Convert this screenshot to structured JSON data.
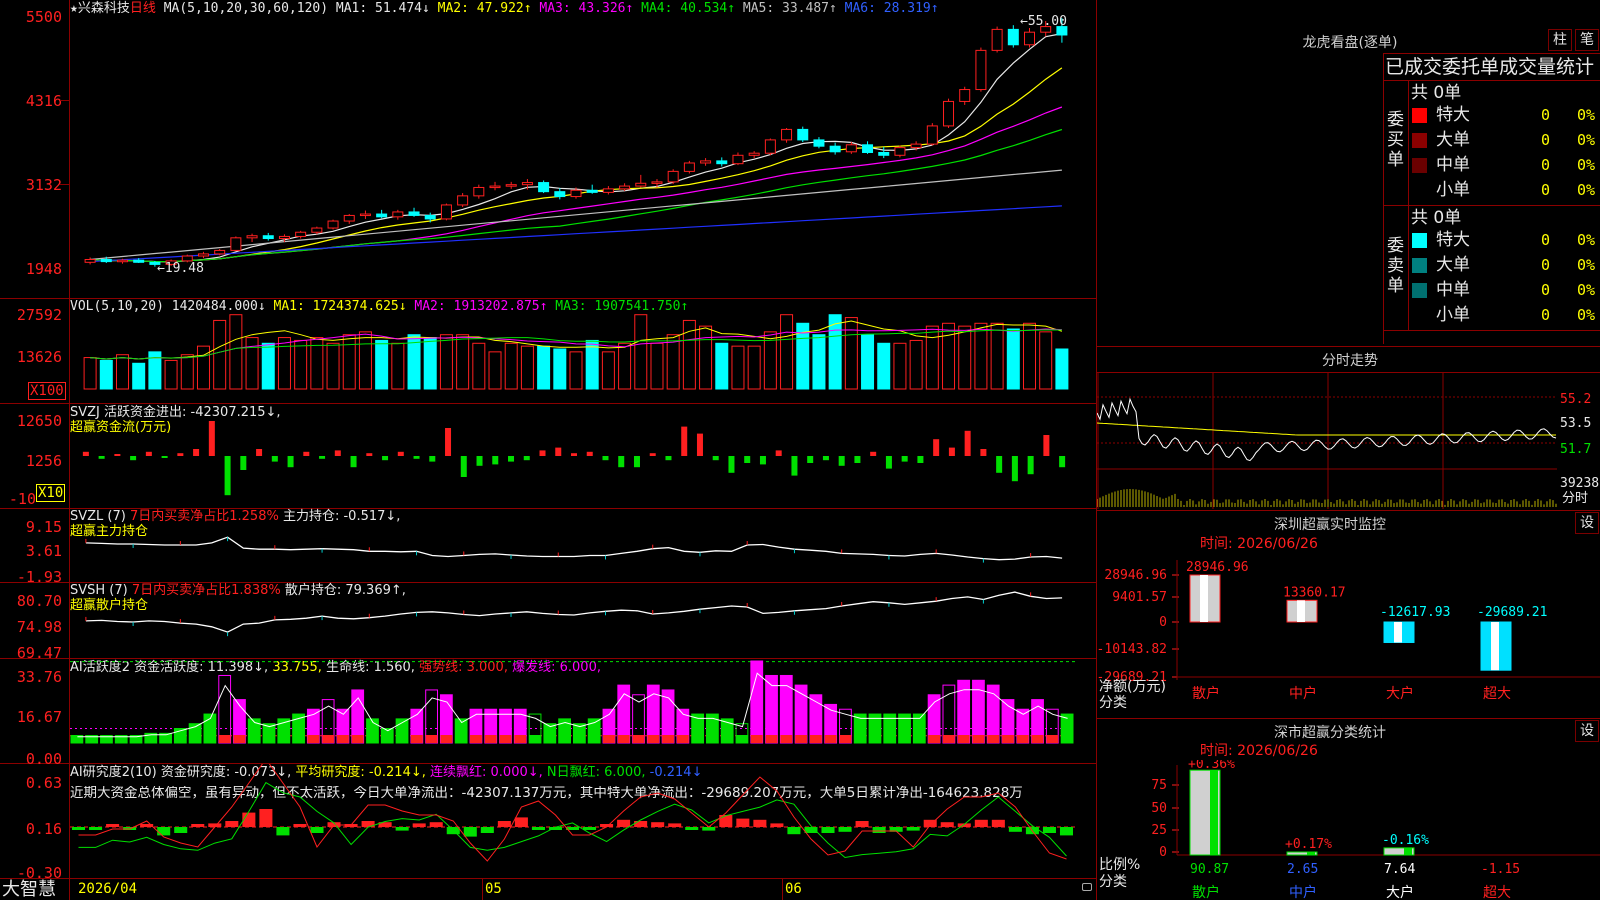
{
  "colors": {
    "up": "#ff2020",
    "down": "#00ffff",
    "grid": "#8b0000",
    "ma1": "#e8e8e8",
    "ma2": "#ffff00",
    "ma3": "#ff00ff",
    "ma4": "#00e000",
    "ma5": "#c0c0c0",
    "ma6": "#2030ff"
  },
  "main": {
    "star": "★",
    "stock": "兴森科技",
    "period": "日线",
    "ma_params": "MA(5,10,20,30,60,120)",
    "ma1": "MA1: 51.474↓",
    "ma2": "MA2: 47.922↑",
    "ma3": "MA3: 43.326↑",
    "ma4": "MA4: 40.534↑",
    "ma5": "MA5: 33.487↑",
    "ma6": "MA6: 28.319↑",
    "high_mark": "55.00",
    "low_mark": "19.48",
    "y_ticks": [
      "5500",
      "4316",
      "3132",
      "1948"
    ]
  },
  "vol": {
    "params": "VOL(5,10,20)",
    "value": "1420484.000↓",
    "ma1": "MA1: 1724374.625↓",
    "ma2": "MA2: 1913202.875↑",
    "ma3": "MA3: 1907541.750↑",
    "y_ticks": [
      "27592",
      "13626"
    ],
    "unit": "X100"
  },
  "svzj": {
    "name": "SVZJ",
    "label": "活跃资金进出: -42307.215↓,",
    "sub": "超赢资金流(万元)",
    "y_ticks": [
      "12650",
      "1256",
      "-10"
    ],
    "unit": "X10"
  },
  "svzl": {
    "name": "SVZL (7)",
    "label1": "7日内买卖净占比1.258%",
    "label2": "主力持仓: -0.517↓,",
    "sub": "超赢主力持仓",
    "y_ticks": [
      "9.15",
      "3.61",
      "-1.93"
    ]
  },
  "svsh": {
    "name": "SVSH (7)",
    "label1": "7日内买卖净占比1.838%",
    "label2": "散户持仓: 79.369↑,",
    "sub": "超赢散户持仓",
    "y_ticks": [
      "80.70",
      "74.98",
      "69.47"
    ]
  },
  "ai1": {
    "name": "AI活跃度2",
    "l1": "资金活跃度: 11.398↓,",
    "l2": "33.755,",
    "l3": "生命线: 1.560,",
    "l4": "强势线: 3.000,",
    "l5": "爆发线: 6.000,",
    "y_ticks": [
      "33.76",
      "16.67",
      "0.00"
    ]
  },
  "ai2": {
    "name": "AI研究度2(10)",
    "l1": "资金研究度: -0.073↓,",
    "l2": "平均研究度: -0.214↓,",
    "l3": "连续飘红: 0.000↓,",
    "l4": "N日飘红: 6.000,",
    "l5": "-0.214↓",
    "comment": "近期大资金总体偏空，虽有异动，但不太活跃，今日大单净流出：-42307.137万元，其中特大单净流出：-29689.207万元，大单5日累计净出-164623.828万",
    "y_ticks": [
      "0.63",
      "0.16",
      "-0.30"
    ]
  },
  "bottom": {
    "brand": "大智慧",
    "date": "2026/04",
    "m05": "05",
    "m06": "06"
  },
  "right": {
    "title": "龙虎看盘(逐单)",
    "btn_zhu": "柱",
    "btn_bi": "笔",
    "header": "已成交委托单成交量统计",
    "buy_side": "委买单",
    "sell_side": "委卖单",
    "buy_total": "共 0单",
    "sell_total": "共 0单",
    "buy_rows": [
      {
        "label": "特大",
        "count": "0",
        "pct": "0%",
        "color": "#ff0000"
      },
      {
        "label": "大单",
        "count": "0",
        "pct": "0%",
        "color": "#8b0000"
      },
      {
        "label": "中单",
        "count": "0",
        "pct": "0%",
        "color": "#6a0000"
      },
      {
        "label": "小单",
        "count": "0",
        "pct": "0%",
        "color": "#000000"
      }
    ],
    "sell_rows": [
      {
        "label": "特大",
        "count": "0",
        "pct": "0%",
        "color": "#00ffff"
      },
      {
        "label": "大单",
        "count": "0",
        "pct": "0%",
        "color": "#008080"
      },
      {
        "label": "中单",
        "count": "0",
        "pct": "0%",
        "color": "#007070"
      },
      {
        "label": "小单",
        "count": "0",
        "pct": "0%",
        "color": "#000000"
      }
    ],
    "intraday_title": "分时走势",
    "intraday_ticks": [
      "55.2",
      "53.5",
      "51.7",
      "39238"
    ],
    "intraday_label": "分时"
  },
  "monitor": {
    "title": "深圳超赢实时监控",
    "settings": "设",
    "time": "时间: 2026/06/26",
    "y_ticks": [
      "28946.96",
      "9401.57",
      "0",
      "-10143.82",
      "-29689.21"
    ],
    "unit_label": "净额(万元)",
    "cat_label": "分类",
    "categories": [
      "散户",
      "中户",
      "大户",
      "超大"
    ],
    "values": [
      "28946.96",
      "13360.17",
      "-12617.93",
      "-29689.21"
    ]
  },
  "classify": {
    "title": "深市超赢分类统计",
    "settings": "设",
    "time": "时间: 2026/06/26",
    "y_ticks": [
      "75",
      "50",
      "25",
      "0"
    ],
    "ratio_label": "比例%",
    "cat_label": "分类",
    "categories": [
      "散户",
      "中户",
      "大户",
      "超大"
    ],
    "pct_change": [
      "+0.36%",
      "+0.17%",
      "-0.16%"
    ],
    "ratios": [
      "90.87",
      "2.65",
      "7.64",
      "-1.15"
    ]
  },
  "chart_data": [
    {
      "type": "candlestick",
      "title": "兴森科技 日线",
      "y_ticks": [
        1948,
        3132,
        4316,
        5500
      ],
      "x_ticks": [
        "2026/04",
        "05",
        "06"
      ],
      "ohlc": [
        [
          20.1,
          20.8,
          19.8,
          20.5
        ],
        [
          20.5,
          20.9,
          20.0,
          20.2
        ],
        [
          20.2,
          20.6,
          19.9,
          20.4
        ],
        [
          20.4,
          20.7,
          20.0,
          20.1
        ],
        [
          20.1,
          20.3,
          19.48,
          19.8
        ],
        [
          19.8,
          20.5,
          19.6,
          20.3
        ],
        [
          20.3,
          21.2,
          20.1,
          21.0
        ],
        [
          21.0,
          21.6,
          20.7,
          21.3
        ],
        [
          21.3,
          22.0,
          21.1,
          21.8
        ],
        [
          21.8,
          23.8,
          21.7,
          23.6
        ],
        [
          23.6,
          24.2,
          23.0,
          23.9
        ],
        [
          23.9,
          24.3,
          23.2,
          23.5
        ],
        [
          23.5,
          24.1,
          23.0,
          23.8
        ],
        [
          23.8,
          24.6,
          23.5,
          24.4
        ],
        [
          24.4,
          25.2,
          24.1,
          25.0
        ],
        [
          25.0,
          26.2,
          24.8,
          26.0
        ],
        [
          26.0,
          27.0,
          25.6,
          26.8
        ],
        [
          26.8,
          27.5,
          26.3,
          27.0
        ],
        [
          27.0,
          27.6,
          26.4,
          26.6
        ],
        [
          26.6,
          27.6,
          26.2,
          27.3
        ],
        [
          27.3,
          27.9,
          26.6,
          26.8
        ],
        [
          26.8,
          27.2,
          25.8,
          26.3
        ],
        [
          26.3,
          28.5,
          26.1,
          28.3
        ],
        [
          28.3,
          30.0,
          28.0,
          29.6
        ],
        [
          29.6,
          31.2,
          29.2,
          30.8
        ],
        [
          30.8,
          31.6,
          30.4,
          31.0
        ],
        [
          31.0,
          31.6,
          30.6,
          31.2
        ],
        [
          31.2,
          32.0,
          30.5,
          31.5
        ],
        [
          31.5,
          31.8,
          30.0,
          30.2
        ],
        [
          30.2,
          30.7,
          29.1,
          29.5
        ],
        [
          29.5,
          30.8,
          29.2,
          30.4
        ],
        [
          30.4,
          31.2,
          29.9,
          30.1
        ],
        [
          30.1,
          31.0,
          29.8,
          30.6
        ],
        [
          30.6,
          31.4,
          30.3,
          31.0
        ],
        [
          31.0,
          32.6,
          30.8,
          31.4
        ],
        [
          31.4,
          32.0,
          30.8,
          31.6
        ],
        [
          31.6,
          33.4,
          31.3,
          33.1
        ],
        [
          33.1,
          34.6,
          32.8,
          34.3
        ],
        [
          34.3,
          35.0,
          33.9,
          34.6
        ],
        [
          34.6,
          35.1,
          33.8,
          34.2
        ],
        [
          34.2,
          35.8,
          34.0,
          35.4
        ],
        [
          35.4,
          36.0,
          35.0,
          35.7
        ],
        [
          35.7,
          37.8,
          35.4,
          37.6
        ],
        [
          37.6,
          39.3,
          37.2,
          39.1
        ],
        [
          39.1,
          39.5,
          37.3,
          37.6
        ],
        [
          37.6,
          38.0,
          36.4,
          36.7
        ],
        [
          36.7,
          37.2,
          35.5,
          35.9
        ],
        [
          35.9,
          37.3,
          35.6,
          36.9
        ],
        [
          36.9,
          37.4,
          35.6,
          35.8
        ],
        [
          35.8,
          36.6,
          35.0,
          35.4
        ],
        [
          35.4,
          36.8,
          35.1,
          36.5
        ],
        [
          36.5,
          37.4,
          36.1,
          37.0
        ],
        [
          37.0,
          40.0,
          36.8,
          39.6
        ],
        [
          39.6,
          43.5,
          39.3,
          43.1
        ],
        [
          43.1,
          45.2,
          42.6,
          44.8
        ],
        [
          44.8,
          50.8,
          44.5,
          50.4
        ],
        [
          50.4,
          53.8,
          50.1,
          53.4
        ],
        [
          53.4,
          54.0,
          50.8,
          51.2
        ],
        [
          51.2,
          53.6,
          50.8,
          53.0
        ],
        [
          53.0,
          54.6,
          52.4,
          53.8
        ],
        [
          53.8,
          55.0,
          51.5,
          52.6
        ]
      ],
      "series": [
        {
          "name": "MA1",
          "last": 51.474
        },
        {
          "name": "MA2",
          "last": 47.922
        },
        {
          "name": "MA3",
          "last": 43.326
        },
        {
          "name": "MA4",
          "last": 40.534
        },
        {
          "name": "MA5",
          "last": 33.487
        },
        {
          "name": "MA6",
          "last": 28.319
        }
      ]
    },
    {
      "type": "bar",
      "title": "VOL(5,10,20)",
      "unit": "X100",
      "y_ticks": [
        13626,
        27592
      ],
      "values": [
        1.1,
        1.0,
        1.2,
        0.9,
        1.3,
        1.0,
        1.2,
        1.5,
        2.4,
        2.6,
        1.8,
        1.6,
        1.8,
        1.7,
        1.8,
        1.6,
        1.9,
        2.0,
        1.7,
        1.6,
        1.9,
        1.8,
        1.9,
        1.9,
        1.6,
        1.3,
        1.6,
        1.5,
        1.5,
        1.4,
        1.3,
        1.7,
        1.3,
        1.6,
        2.6,
        1.6,
        1.9,
        2.4,
        2.2,
        1.6,
        1.5,
        1.5,
        2.0,
        2.6,
        2.3,
        1.9,
        2.6,
        2.5,
        1.9,
        1.6,
        1.6,
        1.7,
        2.2,
        2.3,
        2.2,
        2.3,
        2.3,
        2.1,
        2.3,
        2.0,
        1.4
      ],
      "series": [
        {
          "name": "MA1",
          "last": 1724374.625
        },
        {
          "name": "MA2",
          "last": 1913202.875
        },
        {
          "name": "MA3",
          "last": 1907541.75
        }
      ]
    },
    {
      "type": "bar",
      "title": "SVZJ 活跃资金进出",
      "unit": "万元 X10",
      "values": [
        0.3,
        -0.2,
        0.1,
        -0.3,
        0.3,
        -0.1,
        0.2,
        0.5,
        2.5,
        -2.8,
        -1.0,
        0.5,
        -0.4,
        -0.8,
        0.3,
        -0.2,
        0.4,
        -0.8,
        0.2,
        -0.3,
        0.3,
        -0.2,
        -0.4,
        2.0,
        -1.5,
        -0.7,
        -0.6,
        -0.4,
        -0.3,
        0.4,
        0.6,
        0.2,
        0.3,
        -0.3,
        -0.8,
        -0.8,
        0.2,
        -0.3,
        2.1,
        1.6,
        -0.3,
        -1.2,
        -0.5,
        -0.6,
        0.4,
        -1.4,
        -0.5,
        -0.3,
        -0.7,
        -0.5,
        0.3,
        -0.9,
        -0.4,
        -0.5,
        1.2,
        0.6,
        1.8,
        0.5,
        -1.2,
        -1.8,
        -1.3,
        1.5,
        -0.8
      ]
    },
    {
      "type": "line",
      "title": "SVZL 主力持仓",
      "y_ticks": [
        -1.93,
        3.61,
        9.15
      ],
      "values": [
        4.2,
        4.1,
        4.0,
        4.0,
        3.9,
        3.8,
        3.8,
        3.8,
        4.2,
        5.3,
        3.2,
        3.0,
        3.0,
        2.9,
        3.0,
        3.1,
        3.0,
        2.9,
        2.6,
        2.6,
        2.5,
        2.6,
        1.8,
        1.6,
        1.8,
        2.0,
        2.1,
        1.9,
        1.7,
        1.6,
        1.6,
        1.6,
        1.8,
        1.8,
        2.2,
        2.6,
        3.1,
        3.3,
        2.6,
        2.4,
        2.7,
        2.6,
        3.8,
        3.9,
        3.4,
        3.0,
        2.8,
        2.6,
        2.2,
        2.1,
        2.0,
        1.8,
        1.7,
        2.0,
        2.2,
        1.9,
        1.5,
        1.2,
        1.0,
        1.1,
        1.5,
        1.6,
        1.3
      ]
    },
    {
      "type": "line",
      "title": "SVSH 散户持仓",
      "y_ticks": [
        69.47,
        74.98,
        80.7
      ],
      "values": [
        75.1,
        75.2,
        75.0,
        74.9,
        75.1,
        75.0,
        74.7,
        74.5,
        74.0,
        73.0,
        74.5,
        74.7,
        75.3,
        75.4,
        75.6,
        76.0,
        75.6,
        75.5,
        75.7,
        76.0,
        76.4,
        76.7,
        76.8,
        76.6,
        76.3,
        76.1,
        76.4,
        76.6,
        76.8,
        76.5,
        76.3,
        76.2,
        76.6,
        76.9,
        77.1,
        77.0,
        76.4,
        76.6,
        76.9,
        77.3,
        77.6,
        77.9,
        77.7,
        76.5,
        76.7,
        77.0,
        77.2,
        77.4,
        77.9,
        78.3,
        78.7,
        78.5,
        78.2,
        78.5,
        78.8,
        79.3,
        79.6,
        79.1,
        79.9,
        80.5,
        79.7,
        79.3,
        79.4
      ]
    },
    {
      "type": "bar",
      "title": "AI活跃度2",
      "y_ticks": [
        0.0,
        16.67,
        33.76
      ],
      "values": [
        3,
        3,
        3,
        3,
        3,
        4,
        4,
        6,
        8,
        12,
        28,
        18,
        10,
        8,
        10,
        12,
        14,
        18,
        14,
        22,
        10,
        6,
        10,
        14,
        22,
        20,
        10,
        14,
        14,
        14,
        14,
        12,
        8,
        10,
        8,
        10,
        14,
        24,
        20,
        24,
        22,
        14,
        12,
        12,
        10,
        8,
        34,
        28,
        28,
        24,
        20,
        16,
        14,
        12,
        12,
        12,
        12,
        12,
        20,
        24,
        26,
        26,
        24,
        18,
        14,
        18,
        14,
        12
      ]
    },
    {
      "type": "bar",
      "title": "AI研究度2(10)",
      "y_ticks": [
        -0.3,
        0.16,
        0.63
      ],
      "values": [
        -0.02,
        -0.02,
        0.01,
        -0.02,
        0.02,
        -0.07,
        -0.05,
        0.0,
        0.03,
        0.05,
        0.12,
        0.15,
        -0.07,
        0.0,
        -0.05,
        0.04,
        0.0,
        0.05,
        0.04,
        -0.03,
        0.03,
        0.04,
        -0.06,
        -0.08,
        -0.05,
        0.05,
        0.08,
        -0.02,
        -0.02,
        -0.02,
        -0.02,
        0.02,
        0.06,
        0.05,
        0.04,
        0.03,
        -0.02,
        -0.03,
        0.1,
        0.07,
        0.06,
        0.03,
        -0.06,
        -0.05,
        -0.05,
        -0.04,
        0.05,
        -0.05,
        -0.04,
        -0.03,
        0.06,
        0.04,
        0.03,
        0.06,
        0.06,
        -0.04,
        -0.06,
        -0.05,
        -0.07
      ]
    }
  ]
}
